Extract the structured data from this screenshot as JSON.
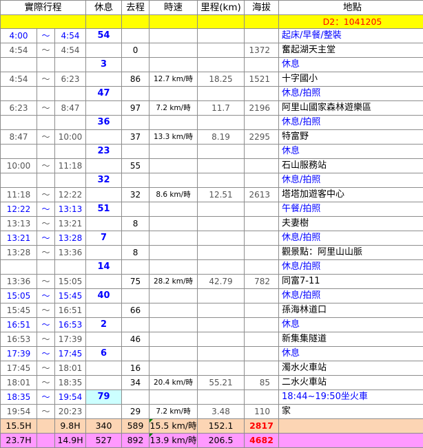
{
  "headers": {
    "time": "實際行程",
    "rest": "休息",
    "dist": "去程",
    "speed": "時速",
    "km": "里程(km)",
    "alt": "海拔",
    "loc": "地點"
  },
  "day_label": "D2：1041205",
  "rows": [
    {
      "type": "blue",
      "from": "4:00",
      "tilde": "～",
      "to": "4:54",
      "rest": "54",
      "dist": "",
      "speed": "",
      "km": "",
      "alt": "",
      "loc": "起床/早餐/整裝"
    },
    {
      "type": "gray",
      "from": "4:54",
      "tilde": "～",
      "to": "4:54",
      "rest": "",
      "dist": "0",
      "speed": "",
      "km": "",
      "alt": "1372",
      "loc": "奮起湖天主堂"
    },
    {
      "type": "blue",
      "from": "",
      "tilde": "",
      "to": "",
      "rest": "3",
      "dist": "",
      "speed": "",
      "km": "",
      "alt": "",
      "loc": "休息"
    },
    {
      "type": "gray",
      "from": "4:54",
      "tilde": "～",
      "to": "6:23",
      "rest": "",
      "dist": "86",
      "speed": "12.7 km/時",
      "km": "18.25",
      "alt": "1521",
      "loc": "十字國小"
    },
    {
      "type": "blue",
      "from": "",
      "tilde": "",
      "to": "",
      "rest": "47",
      "dist": "",
      "speed": "",
      "km": "",
      "alt": "",
      "loc": "休息/拍照"
    },
    {
      "type": "gray",
      "from": "6:23",
      "tilde": "～",
      "to": "8:47",
      "rest": "",
      "dist": "97",
      "speed": "7.2 km/時",
      "km": "11.7",
      "alt": "2196",
      "loc": "阿里山國家森林遊樂區"
    },
    {
      "type": "blue",
      "from": "",
      "tilde": "",
      "to": "",
      "rest": "36",
      "dist": "",
      "speed": "",
      "km": "",
      "alt": "",
      "loc": "休息/拍照"
    },
    {
      "type": "gray",
      "from": "8:47",
      "tilde": "～",
      "to": "10:00",
      "rest": "",
      "dist": "37",
      "speed": "13.3 km/時",
      "km": "8.19",
      "alt": "2295",
      "loc": "特富野"
    },
    {
      "type": "blue",
      "from": "",
      "tilde": "",
      "to": "",
      "rest": "23",
      "dist": "",
      "speed": "",
      "km": "",
      "alt": "",
      "loc": "休息"
    },
    {
      "type": "gray",
      "from": "10:00",
      "tilde": "～",
      "to": "11:18",
      "rest": "",
      "dist": "55",
      "speed": "",
      "km": "",
      "alt": "",
      "loc": "石山服務站"
    },
    {
      "type": "blue",
      "from": "",
      "tilde": "",
      "to": "",
      "rest": "32",
      "dist": "",
      "speed": "",
      "km": "",
      "alt": "",
      "loc": "休息/拍照"
    },
    {
      "type": "gray",
      "from": "11:18",
      "tilde": "～",
      "to": "12:22",
      "rest": "",
      "dist": "32",
      "speed": "8.6 km/時",
      "km": "12.51",
      "alt": "2613",
      "loc": "塔塔加遊客中心"
    },
    {
      "type": "blue",
      "from": "12:22",
      "tilde": "～",
      "to": "13:13",
      "rest": "51",
      "dist": "",
      "speed": "",
      "km": "",
      "alt": "",
      "loc": "午餐/拍照"
    },
    {
      "type": "gray",
      "from": "13:13",
      "tilde": "～",
      "to": "13:21",
      "rest": "",
      "dist": "8",
      "speed": "",
      "km": "",
      "alt": "",
      "loc": "夫妻樹"
    },
    {
      "type": "blue",
      "from": "13:21",
      "tilde": "～",
      "to": "13:28",
      "rest": "7",
      "dist": "",
      "speed": "",
      "km": "",
      "alt": "",
      "loc": "休息/拍照"
    },
    {
      "type": "gray",
      "from": "13:28",
      "tilde": "～",
      "to": "13:36",
      "rest": "",
      "dist": "8",
      "speed": "",
      "km": "",
      "alt": "",
      "loc": "觀景點：阿里山山脈"
    },
    {
      "type": "blue",
      "from": "",
      "tilde": "",
      "to": "",
      "rest": "14",
      "dist": "",
      "speed": "",
      "km": "",
      "alt": "",
      "loc": "休息/拍照"
    },
    {
      "type": "gray",
      "from": "13:36",
      "tilde": "～",
      "to": "15:05",
      "rest": "",
      "dist": "75",
      "speed": "28.2 km/時",
      "km": "42.79",
      "alt": "782",
      "loc": "同富7-11"
    },
    {
      "type": "blue",
      "from": "15:05",
      "tilde": "～",
      "to": "15:45",
      "rest": "40",
      "dist": "",
      "speed": "",
      "km": "",
      "alt": "",
      "loc": "休息/拍照"
    },
    {
      "type": "gray",
      "from": "15:45",
      "tilde": "～",
      "to": "16:51",
      "rest": "",
      "dist": "66",
      "speed": "",
      "km": "",
      "alt": "",
      "loc": "孫海林道口"
    },
    {
      "type": "blue",
      "from": "16:51",
      "tilde": "～",
      "to": "16:53",
      "rest": "2",
      "dist": "",
      "speed": "",
      "km": "",
      "alt": "",
      "loc": "休息"
    },
    {
      "type": "gray",
      "from": "16:53",
      "tilde": "～",
      "to": "17:39",
      "rest": "",
      "dist": "46",
      "speed": "",
      "km": "",
      "alt": "",
      "loc": "新集集隧道"
    },
    {
      "type": "blue",
      "from": "17:39",
      "tilde": "～",
      "to": "17:45",
      "rest": "6",
      "dist": "",
      "speed": "",
      "km": "",
      "alt": "",
      "loc": "休息"
    },
    {
      "type": "gray",
      "from": "17:45",
      "tilde": "～",
      "to": "18:01",
      "rest": "",
      "dist": "16",
      "speed": "",
      "km": "",
      "alt": "",
      "loc": "濁水火車站"
    },
    {
      "type": "gray",
      "from": "18:01",
      "tilde": "～",
      "to": "18:35",
      "rest": "",
      "dist": "34",
      "speed": "20.4 km/時",
      "km": "55.21",
      "alt": "85",
      "loc": "二水火車站"
    },
    {
      "type": "blue",
      "from": "18:35",
      "tilde": "～",
      "to": "19:54",
      "rest": "79",
      "restHighlight": true,
      "dist": "",
      "speed": "",
      "km": "",
      "alt": "",
      "loc": "18:44~19:50坐火車"
    },
    {
      "type": "gray",
      "from": "19:54",
      "tilde": "～",
      "to": "20:23",
      "rest": "",
      "dist": "29",
      "speed": "7.2 km/時",
      "km": "3.48",
      "alt": "110",
      "loc": "家"
    }
  ],
  "summary": [
    {
      "from": "15.5H",
      "to": "9.8H",
      "rest": "340",
      "dist": "589",
      "speed": "15.5 km/時",
      "km": "152.1",
      "alt": "2817",
      "loc": ""
    },
    {
      "from": "23.7H",
      "to": "14.9H",
      "rest": "527",
      "dist": "892",
      "speed": "13.9 km/時",
      "km": "206.5",
      "alt": "4682",
      "loc": ""
    }
  ],
  "colors": {
    "day_bar": "#ffff00",
    "day_text": "#ff0000",
    "rest_text": "#0000ff",
    "summary1_bg": "#fcd5b4",
    "summary2_bg": "#ff99ff",
    "alt_highlight": "#ff0000",
    "rest_highlight_bg": "#ccffff"
  }
}
